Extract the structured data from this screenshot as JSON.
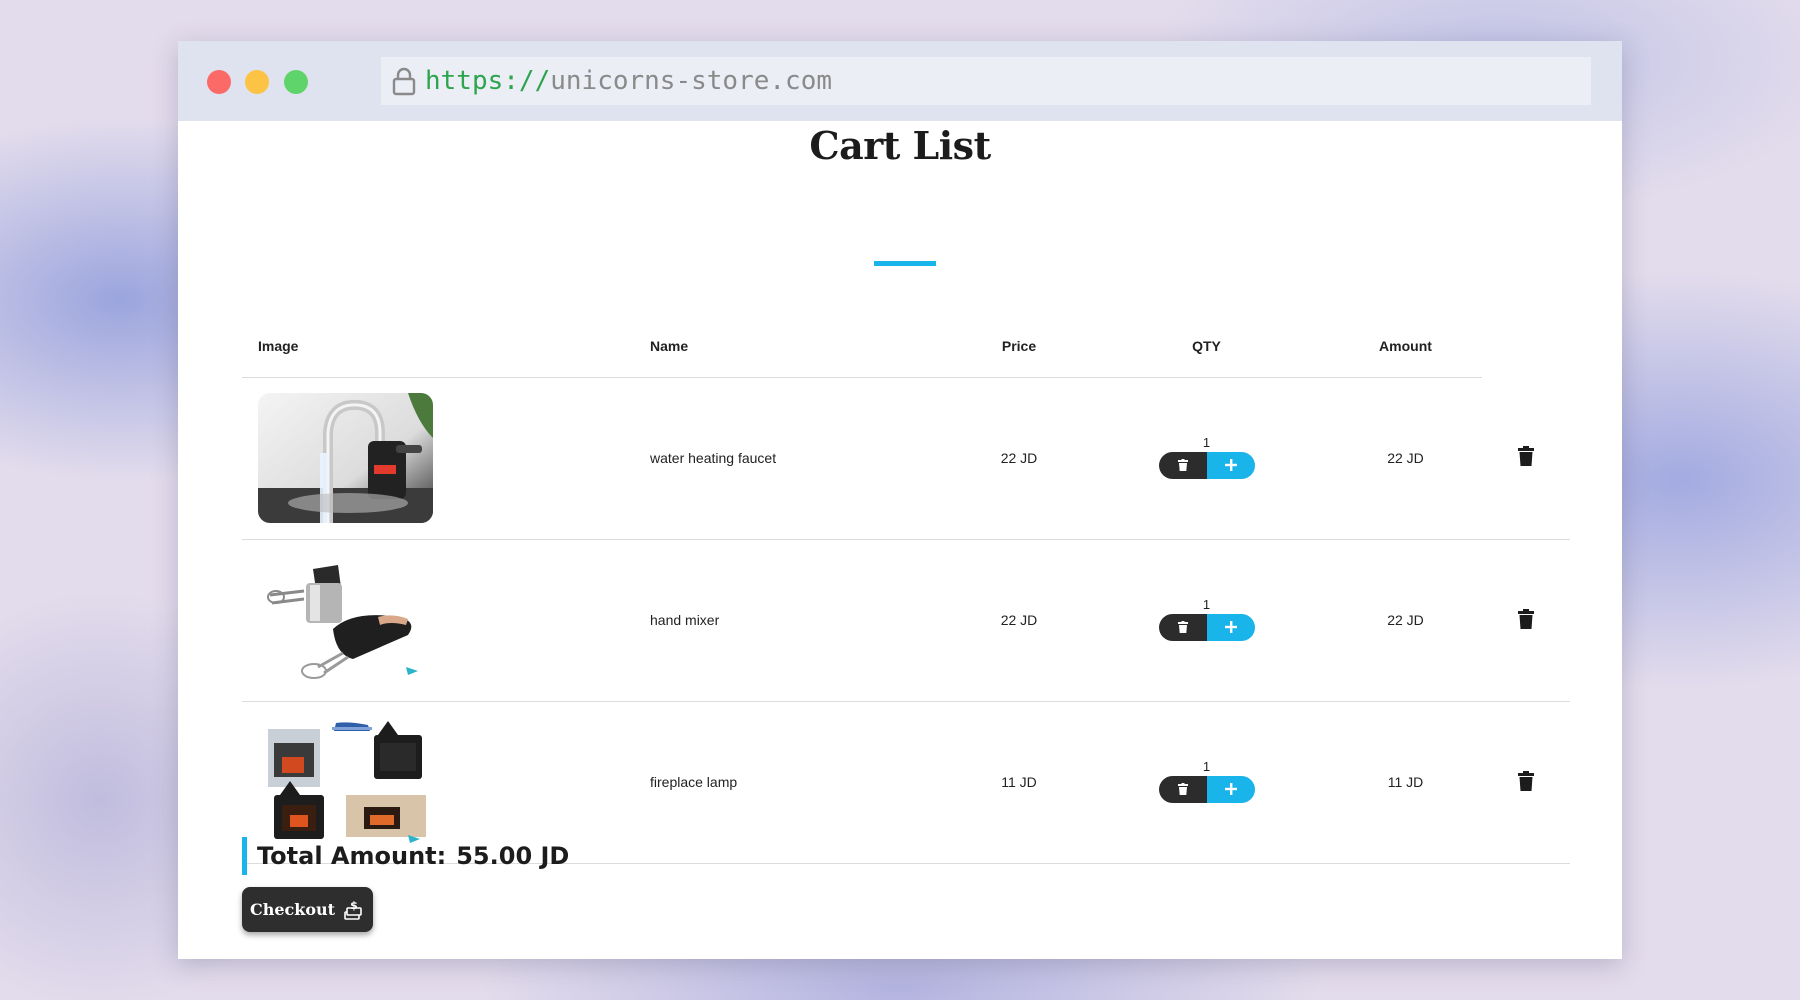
{
  "browser": {
    "url_scheme": "https://",
    "url_host": "unicorns-store.com"
  },
  "page": {
    "title": "Cart List"
  },
  "table": {
    "headers": {
      "image": "Image",
      "name": "Name",
      "price": "Price",
      "qty": "QTY",
      "amount": "Amount"
    },
    "rows": [
      {
        "image": "water-heating-faucet-photo",
        "name": "water heating faucet",
        "price": "22 JD",
        "qty": "1",
        "amount": "22 JD"
      },
      {
        "image": "hand-mixer-photo",
        "name": "hand mixer",
        "price": "22 JD",
        "qty": "1",
        "amount": "22 JD"
      },
      {
        "image": "fireplace-lamp-photo",
        "name": "fireplace lamp",
        "price": "11 JD",
        "qty": "1",
        "amount": "11 JD"
      }
    ]
  },
  "summary": {
    "total_label": "Total Amount:",
    "total_value": "55.00 JD"
  },
  "actions": {
    "checkout_label": "Checkout",
    "checkout_icon": "money-stack-icon"
  },
  "colors": {
    "accent": "#18b4ea",
    "dark_button": "#2c2c2c"
  }
}
